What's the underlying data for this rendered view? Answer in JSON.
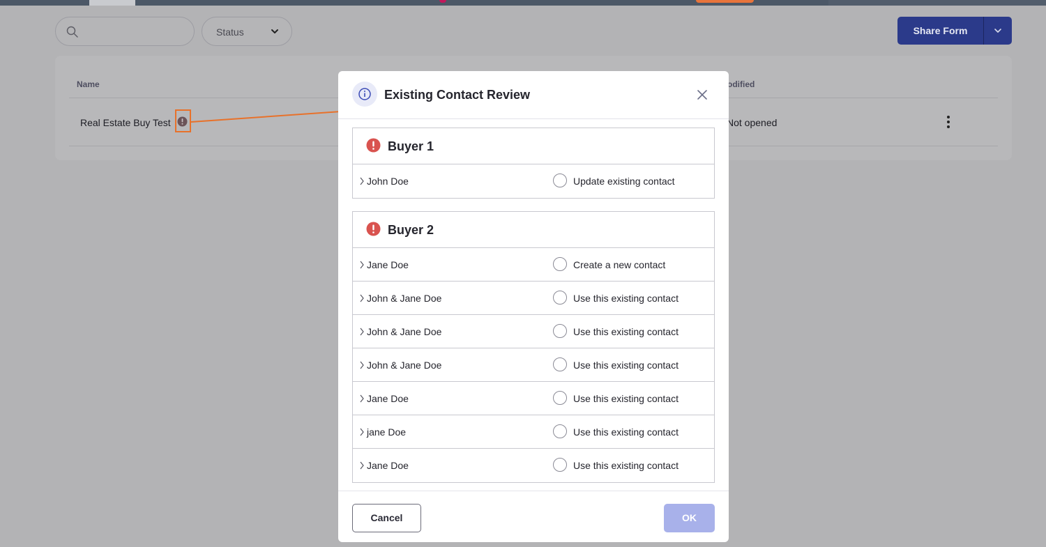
{
  "filters": {
    "search_placeholder": "",
    "status_label": "Status"
  },
  "toolbar": {
    "share_label": "Share Form"
  },
  "table": {
    "columns": [
      "Name",
      "odified"
    ],
    "rows": [
      {
        "name": "Real Estate Buy Test",
        "status": "Not opened"
      }
    ]
  },
  "modal": {
    "title": "Existing Contact Review",
    "groups": [
      {
        "title": "Buyer 1",
        "rows": [
          {
            "name": "John Doe",
            "option": "Update existing contact"
          }
        ]
      },
      {
        "title": "Buyer 2",
        "rows": [
          {
            "name": "Jane Doe",
            "option": "Create a new contact"
          },
          {
            "name": "John & Jane Doe",
            "option": "Use this existing contact"
          },
          {
            "name": "John & Jane Doe",
            "option": "Use this existing contact"
          },
          {
            "name": "John & Jane Doe",
            "option": "Use this existing contact"
          },
          {
            "name": "Jane Doe",
            "option": "Use this existing contact"
          },
          {
            "name": "jane Doe",
            "option": "Use this existing contact"
          },
          {
            "name": "Jane Doe",
            "option": "Use this existing contact"
          }
        ]
      }
    ],
    "cancel_label": "Cancel",
    "ok_label": "OK"
  },
  "icons": {
    "search": "search-icon",
    "chevron": "chevron-down-icon",
    "alert": "alert-circle-icon",
    "info": "info-icon",
    "close": "close-icon",
    "kebab": "kebab-menu-icon"
  },
  "colors": {
    "accent": "#2b3a8a",
    "annotation": "#e8712a",
    "warning": "#d9534f",
    "ok_disabled": "#a8b1ea"
  }
}
